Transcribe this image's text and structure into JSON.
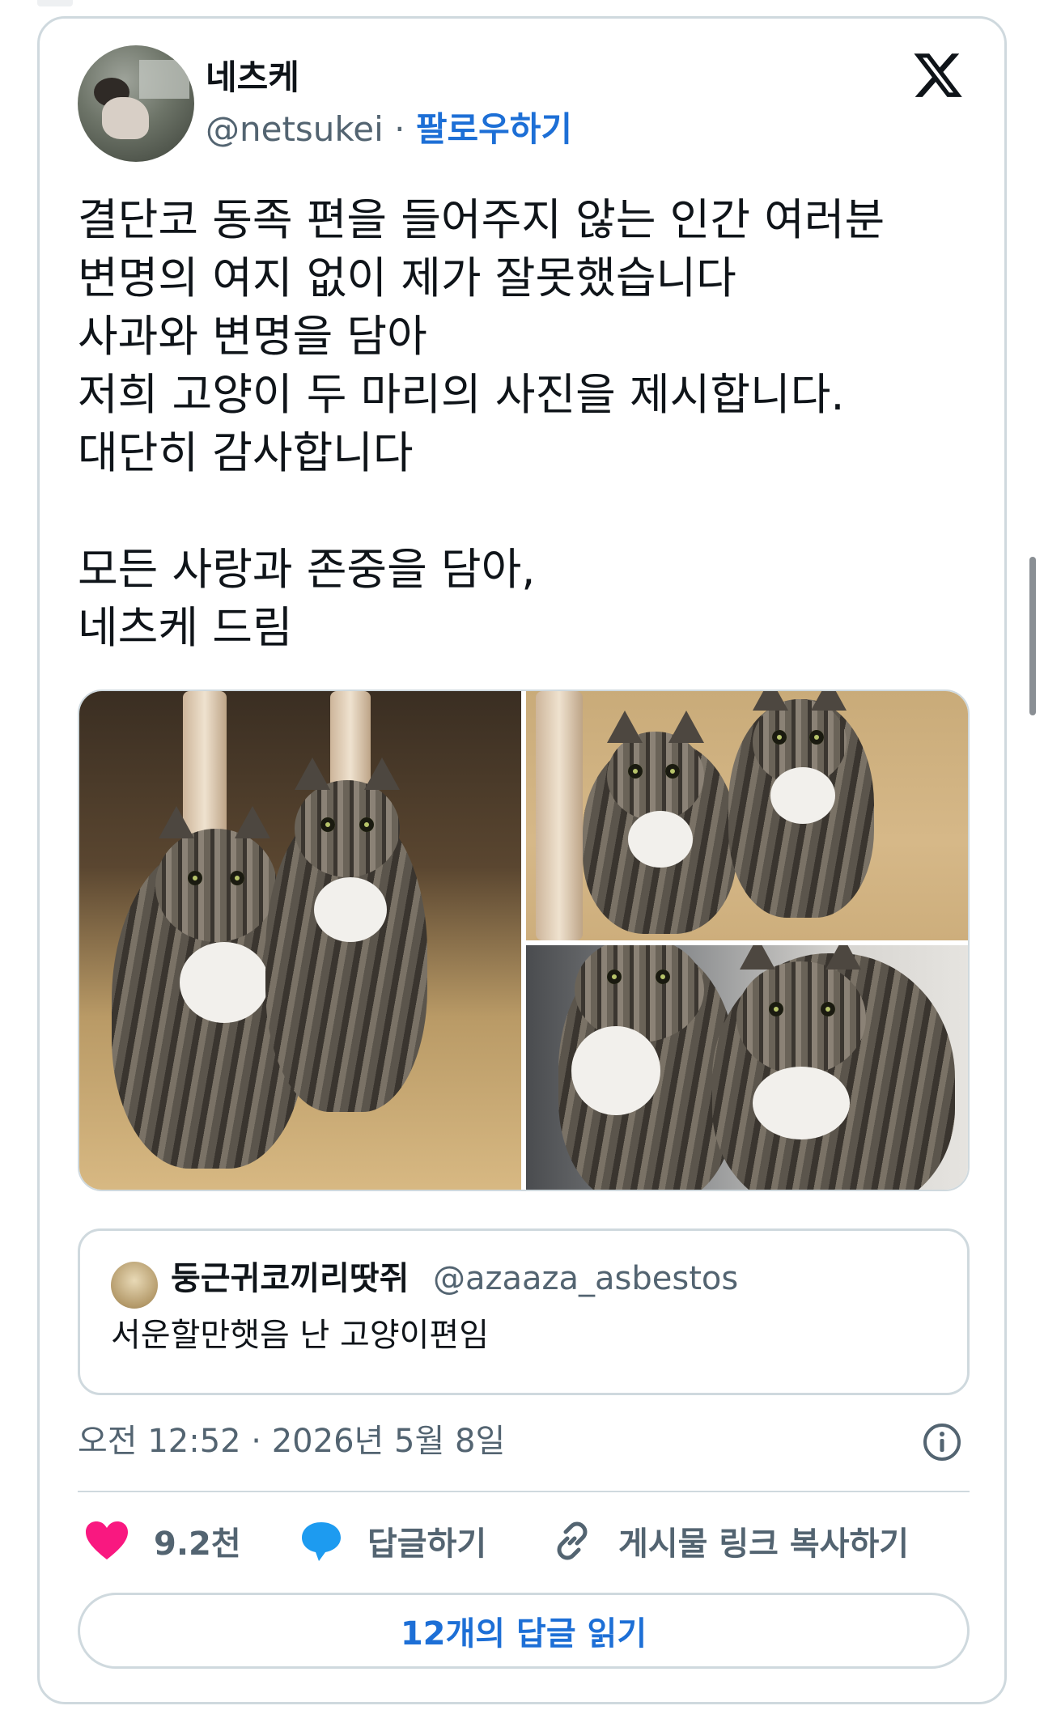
{
  "tweet": {
    "author": {
      "display_name": "네츠케",
      "handle": "@netsukei",
      "separator": "·",
      "follow_label": "팔로우하기"
    },
    "text": "결단코 동족 편을 들어주지 않는 인간 여러분\n변명의 여지 없이 제가 잘못했습니다\n사과와 변명을 담아\n저희 고양이 두 마리의 사진을 제시합니다.\n대단히 감사합니다\n\n모든 사랑과 존중을 담아,\n네츠케 드림",
    "media_count": 3,
    "quoted": {
      "display_name": "둥근귀코끼리땃쥐",
      "handle": "@azaaza_asbestos",
      "text": "서운할만햇음 난 고양이편임"
    },
    "timestamp": "오전 12:52 · 2026년 5월 8일",
    "actions": {
      "like_count": "9.2천",
      "reply_label": "답글하기",
      "copy_link_label": "게시물 링크 복사하기"
    },
    "read_replies_label": "12개의 답글 읽기"
  },
  "icons": {
    "brand": "x-logo-icon",
    "info": "info-icon",
    "like": "heart-icon",
    "reply": "speech-bubble-icon",
    "copy": "link-icon"
  },
  "colors": {
    "like": "#f91880",
    "reply": "#1d9bf0",
    "accent": "#1d6fd6",
    "muted": "#536471"
  }
}
